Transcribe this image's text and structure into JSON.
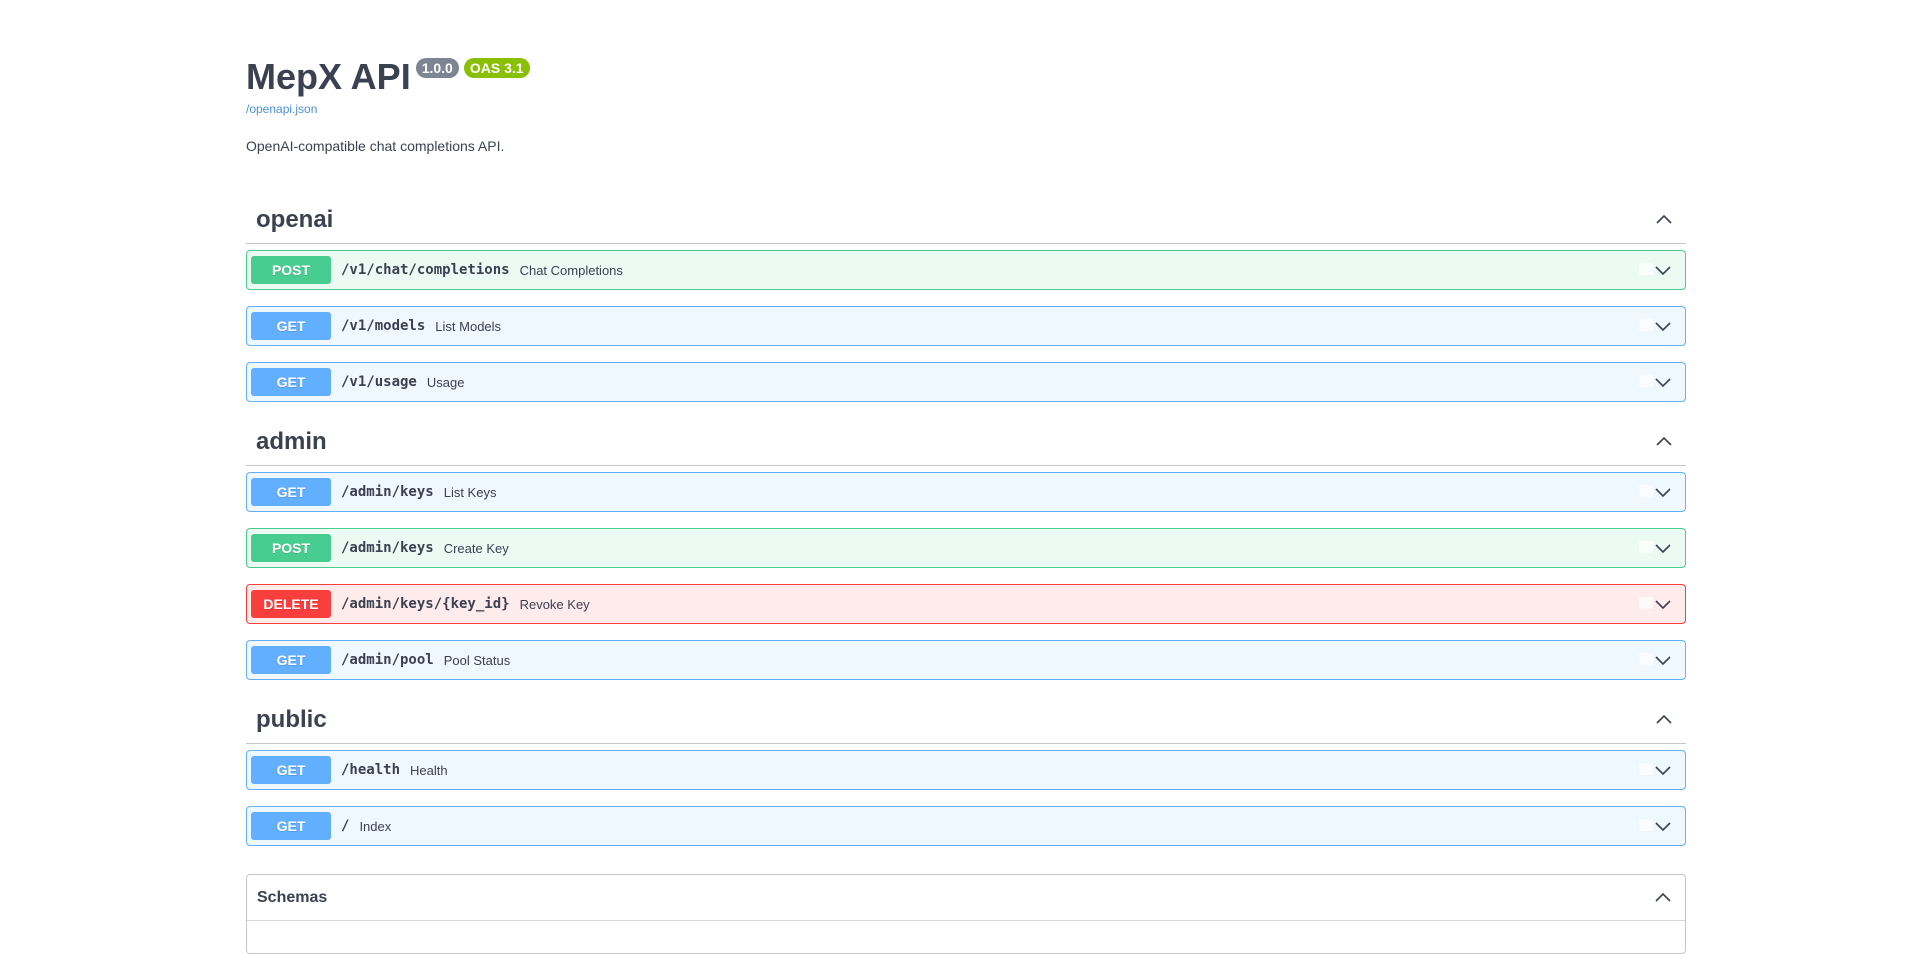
{
  "info": {
    "title": "MepX API",
    "version_badge": "1.0.0",
    "oas_badge": "OAS 3.1",
    "spec_link": "/openapi.json",
    "description": "OpenAI-compatible chat completions API."
  },
  "colors": {
    "get": "#61affe",
    "post": "#49cc90",
    "delete": "#f93e3e",
    "version_badge": "#7d8492",
    "oas_badge": "#89bf04",
    "link": "#4990e2"
  },
  "tags": [
    {
      "name": "openai",
      "expanded": true,
      "operations": [
        {
          "method": "POST",
          "path": "/v1/chat/completions",
          "summary": "Chat Completions"
        },
        {
          "method": "GET",
          "path": "/v1/models",
          "summary": "List Models"
        },
        {
          "method": "GET",
          "path": "/v1/usage",
          "summary": "Usage"
        }
      ]
    },
    {
      "name": "admin",
      "expanded": true,
      "operations": [
        {
          "method": "GET",
          "path": "/admin/keys",
          "summary": "List Keys"
        },
        {
          "method": "POST",
          "path": "/admin/keys",
          "summary": "Create Key"
        },
        {
          "method": "DELETE",
          "path": "/admin/keys/{key_id}",
          "summary": "Revoke Key"
        },
        {
          "method": "GET",
          "path": "/admin/pool",
          "summary": "Pool Status"
        }
      ]
    },
    {
      "name": "public",
      "expanded": true,
      "operations": [
        {
          "method": "GET",
          "path": "/health",
          "summary": "Health"
        },
        {
          "method": "GET",
          "path": "/",
          "summary": "Index"
        }
      ]
    }
  ],
  "schemas": {
    "title": "Schemas",
    "expanded": true
  },
  "icons": {
    "tag_toggle": "chevron-up-icon",
    "op_toggle": "chevron-down-icon"
  }
}
